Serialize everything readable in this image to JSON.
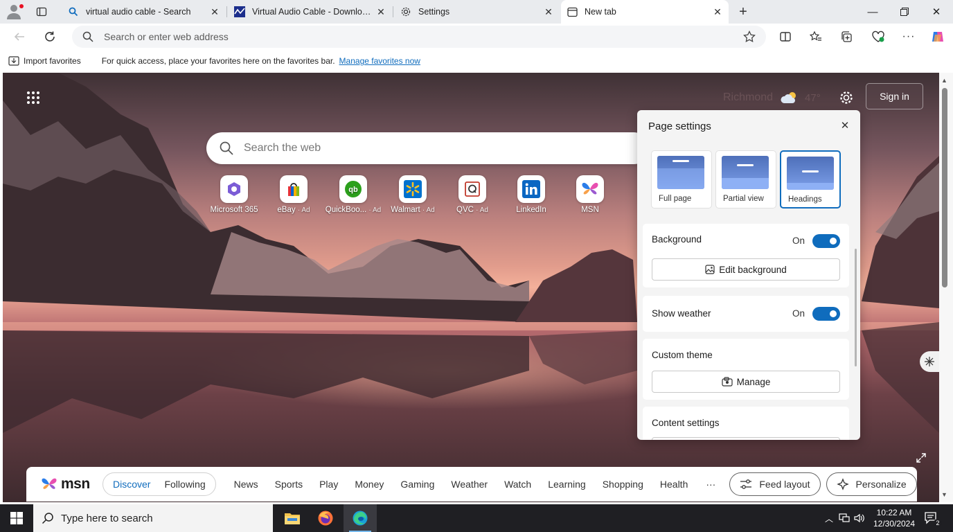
{
  "tabs": [
    {
      "label": "virtual audio cable - Search",
      "icon": "search-icon",
      "active": false
    },
    {
      "label": "Virtual Audio Cable - Downloads",
      "icon": "vac-site-icon",
      "active": false
    },
    {
      "label": "Settings",
      "icon": "gear-icon",
      "active": false
    },
    {
      "label": "New tab",
      "icon": "newtab-icon",
      "active": true
    }
  ],
  "toolbar": {
    "address_placeholder": "Search or enter web address"
  },
  "favorites_bar": {
    "import_label": "Import favorites",
    "message": "For quick access, place your favorites here on the favorites bar.",
    "link": "Manage favorites now"
  },
  "newtab": {
    "weather_city": "Richmond",
    "weather_temp": "47°",
    "sign_in": "Sign in",
    "search_placeholder": "Search the web",
    "quick_links": [
      {
        "name": "Microsoft 365",
        "ad": "",
        "color": "#7b5cd6"
      },
      {
        "name": "eBay",
        "ad": "· Ad",
        "color": "#e53238"
      },
      {
        "name": "QuickBoo...",
        "ad": "· Ad",
        "color": "#2ca01c"
      },
      {
        "name": "Walmart",
        "ad": "· Ad",
        "color": "#0071ce"
      },
      {
        "name": "QVC",
        "ad": "· Ad",
        "color": "#c0392b"
      },
      {
        "name": "LinkedIn",
        "ad": "",
        "color": "#0a66c2"
      },
      {
        "name": "MSN",
        "ad": "",
        "color": "#d23fa9"
      }
    ]
  },
  "page_settings": {
    "title": "Page settings",
    "layouts": [
      {
        "label": "Full page",
        "selected": false
      },
      {
        "label": "Partial view",
        "selected": false
      },
      {
        "label": "Headings",
        "selected": true
      }
    ],
    "background": {
      "label": "Background",
      "state": "On",
      "button": "Edit background"
    },
    "weather": {
      "label": "Show weather",
      "state": "On"
    },
    "theme": {
      "label": "Custom theme",
      "button": "Manage"
    },
    "content": {
      "label": "Content settings"
    }
  },
  "msn": {
    "logo": "msn",
    "feed_tabs": [
      "Discover",
      "Following"
    ],
    "nav": [
      "News",
      "Sports",
      "Play",
      "Money",
      "Gaming",
      "Weather",
      "Watch",
      "Learning",
      "Shopping",
      "Health"
    ],
    "more": "···",
    "feed_layout": "Feed layout",
    "personalize": "Personalize"
  },
  "taskbar": {
    "search_placeholder": "Type here to search",
    "time": "10:22 AM",
    "date": "12/30/2024",
    "notifications": "2"
  },
  "colors": {
    "accent": "#0f6cbd"
  }
}
